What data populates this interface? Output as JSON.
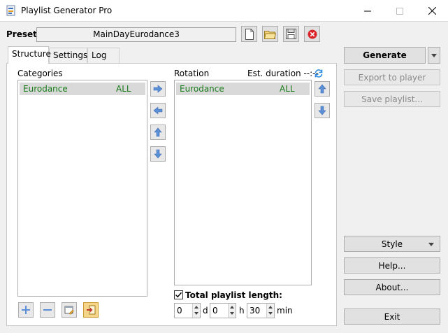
{
  "window": {
    "title": "Playlist Generator Pro"
  },
  "preset": {
    "label": "Preset",
    "value": "MainDayEurodance3"
  },
  "tabs": [
    {
      "label": "Structure"
    },
    {
      "label": "Settings"
    },
    {
      "label": "Log"
    }
  ],
  "categories": {
    "label": "Categories",
    "items": [
      {
        "name": "Eurodance",
        "value": "ALL"
      }
    ]
  },
  "rotation": {
    "label": "Rotation",
    "est_duration_label": "Est. duration --:--",
    "items": [
      {
        "name": "Eurodance",
        "value": "ALL"
      }
    ]
  },
  "total_length": {
    "label": "Total playlist length:",
    "checked": true,
    "days": "0",
    "days_unit": "d",
    "hours": "0",
    "hours_unit": "h",
    "minutes": "30",
    "minutes_unit": "min"
  },
  "actions": {
    "generate": "Generate",
    "export": "Export to player",
    "save_playlist": "Save playlist...",
    "style": "Style",
    "help": "Help...",
    "about": "About...",
    "exit": "Exit"
  },
  "colors": {
    "list_text": "#1a7a1a",
    "arrow_blue": "#5b8fd6",
    "close_red": "#d9262b"
  }
}
